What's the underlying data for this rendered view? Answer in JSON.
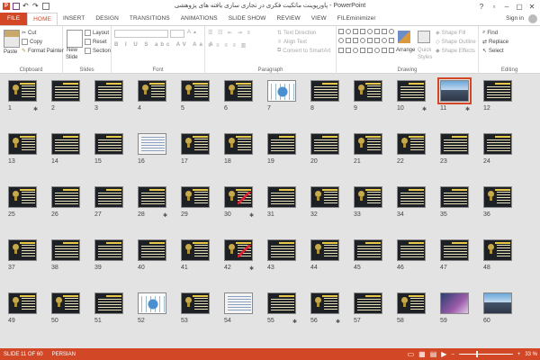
{
  "app": {
    "window_title": "پاورپوینت ماتکیت فکری در تجاری سازی یافته های پژوهشی - PowerPoint",
    "logo_letter": "P",
    "sign_in": "Sign in",
    "window_controls": [
      "?",
      "▫",
      "–",
      "▢",
      "✕"
    ]
  },
  "tabs": [
    {
      "label": "FILE",
      "kind": "file"
    },
    {
      "label": "HOME",
      "kind": "active"
    },
    {
      "label": "INSERT",
      "kind": ""
    },
    {
      "label": "DESIGN",
      "kind": ""
    },
    {
      "label": "TRANSITIONS",
      "kind": ""
    },
    {
      "label": "ANIMATIONS",
      "kind": ""
    },
    {
      "label": "SLIDE SHOW",
      "kind": ""
    },
    {
      "label": "REVIEW",
      "kind": ""
    },
    {
      "label": "VIEW",
      "kind": ""
    },
    {
      "label": "FILEminimizer",
      "kind": ""
    }
  ],
  "ribbon": {
    "clipboard": {
      "label": "Clipboard",
      "paste": "Paste",
      "cut": "Cut",
      "copy": "Copy",
      "format_painter": "Format Painter"
    },
    "slides": {
      "label": "Slides",
      "new_slide": "New",
      "new_slide_2": "Slide",
      "layout": "Layout",
      "reset": "Reset",
      "section": "Section"
    },
    "font": {
      "label": "Font"
    },
    "paragraph": {
      "label": "Paragraph",
      "text_direction": "Text Direction",
      "align_text": "Align Text",
      "convert_smartart": "Convert to SmartArt"
    },
    "drawing": {
      "label": "Drawing",
      "arrange": "Arrange",
      "quick_styles": "Quick",
      "quick_styles_2": "Styles",
      "shape_fill": "Shape Fill",
      "shape_outline": "Shape Outline",
      "shape_effects": "Shape Effects"
    },
    "editing": {
      "label": "Editing",
      "find": "Find",
      "replace": "Replace",
      "select": "Select"
    }
  },
  "slides": [
    {
      "n": "1",
      "style": "title",
      "star": true
    },
    {
      "n": "2",
      "style": "content",
      "star": false
    },
    {
      "n": "3",
      "style": "content",
      "star": false
    },
    {
      "n": "4",
      "style": "title",
      "star": false
    },
    {
      "n": "5",
      "style": "title",
      "star": false
    },
    {
      "n": "6",
      "style": "title",
      "star": false
    },
    {
      "n": "7",
      "style": "diagram",
      "star": false
    },
    {
      "n": "8",
      "style": "content",
      "star": false
    },
    {
      "n": "9",
      "style": "title",
      "star": false
    },
    {
      "n": "10",
      "style": "content",
      "star": true
    },
    {
      "n": "11",
      "style": "city",
      "star": true
    },
    {
      "n": "12",
      "style": "content",
      "star": false
    },
    {
      "n": "13",
      "style": "title",
      "star": false
    },
    {
      "n": "14",
      "style": "content",
      "star": false
    },
    {
      "n": "15",
      "style": "content",
      "star": false
    },
    {
      "n": "16",
      "style": "doc",
      "star": false
    },
    {
      "n": "17",
      "style": "title",
      "star": false
    },
    {
      "n": "18",
      "style": "title",
      "star": false
    },
    {
      "n": "19",
      "style": "content",
      "star": false
    },
    {
      "n": "20",
      "style": "content",
      "star": false
    },
    {
      "n": "21",
      "style": "title",
      "star": false
    },
    {
      "n": "22",
      "style": "title",
      "star": false
    },
    {
      "n": "23",
      "style": "content",
      "star": false
    },
    {
      "n": "24",
      "style": "content",
      "star": false
    },
    {
      "n": "25",
      "style": "title",
      "star": false
    },
    {
      "n": "26",
      "style": "content",
      "star": false
    },
    {
      "n": "27",
      "style": "content",
      "star": false
    },
    {
      "n": "28",
      "style": "content",
      "star": true
    },
    {
      "n": "29",
      "style": "title",
      "star": false
    },
    {
      "n": "30",
      "style": "red",
      "star": true
    },
    {
      "n": "31",
      "style": "content",
      "star": false
    },
    {
      "n": "32",
      "style": "title",
      "star": false
    },
    {
      "n": "33",
      "style": "title",
      "star": false
    },
    {
      "n": "34",
      "style": "content",
      "star": false
    },
    {
      "n": "35",
      "style": "content",
      "star": false
    },
    {
      "n": "36",
      "style": "title",
      "star": false
    },
    {
      "n": "37",
      "style": "title",
      "star": false
    },
    {
      "n": "38",
      "style": "content",
      "star": false
    },
    {
      "n": "39",
      "style": "content",
      "star": false
    },
    {
      "n": "40",
      "style": "content",
      "star": false
    },
    {
      "n": "41",
      "style": "title",
      "star": false
    },
    {
      "n": "42",
      "style": "red",
      "star": true
    },
    {
      "n": "43",
      "style": "content",
      "star": false
    },
    {
      "n": "44",
      "style": "title",
      "star": false
    },
    {
      "n": "45",
      "style": "content",
      "star": false
    },
    {
      "n": "46",
      "style": "content",
      "star": false
    },
    {
      "n": "47",
      "style": "content",
      "star": false
    },
    {
      "n": "48",
      "style": "title",
      "star": false
    },
    {
      "n": "49",
      "style": "title",
      "star": false
    },
    {
      "n": "50",
      "style": "title",
      "star": false
    },
    {
      "n": "51",
      "style": "content",
      "star": false
    },
    {
      "n": "52",
      "style": "diagram",
      "star": false
    },
    {
      "n": "53",
      "style": "title",
      "star": false
    },
    {
      "n": "54",
      "style": "doc",
      "star": false
    },
    {
      "n": "55",
      "style": "content",
      "star": true
    },
    {
      "n": "56",
      "style": "title",
      "star": true
    },
    {
      "n": "57",
      "style": "content",
      "star": false
    },
    {
      "n": "58",
      "style": "title",
      "star": false
    },
    {
      "n": "59",
      "style": "photo",
      "star": false
    },
    {
      "n": "60",
      "style": "city",
      "star": false
    }
  ],
  "selected_slide": "11",
  "star_glyph": "✱",
  "status": {
    "slide_info": "SLIDE 11 OF 60",
    "language": "PERSIAN",
    "zoom": "33 %",
    "zoom_level": 0.33
  },
  "colors": {
    "accent": "#d24726",
    "slide_bg": "#1d2126"
  }
}
